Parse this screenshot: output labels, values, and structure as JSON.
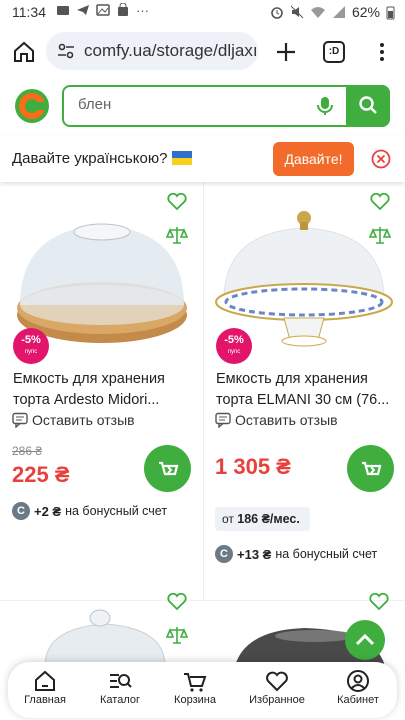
{
  "status_bar": {
    "time": "11:34",
    "battery": "62%"
  },
  "browser": {
    "url": "comfy.ua/storage/dljaxı",
    "tab_count": ":D"
  },
  "site": {
    "search_value": "блен"
  },
  "lang_banner": {
    "text": "Давайте українською?",
    "button": "Давайте!"
  },
  "products": [
    {
      "badge": "-5%",
      "badge_sub": "пупс",
      "name_line1": "Емкость для хранения",
      "name_line2": "торта Ardesto Midori...",
      "review": "Оставить отзыв",
      "old_price": "286 ₴",
      "price": "225 ₴",
      "bonus_amount": "+2 ₴",
      "bonus_text": "на бонусный счет"
    },
    {
      "badge": "-5%",
      "badge_sub": "пупс",
      "name_line1": "Емкость для хранения",
      "name_line2": "торта ELMANI 30 см (76...",
      "review": "Оставить отзыв",
      "price": "1 305 ₴",
      "credit_prefix": "от",
      "credit_value": "186 ₴/мес.",
      "bonus_amount": "+13 ₴",
      "bonus_text": "на бонусный счет"
    }
  ],
  "nav": [
    {
      "label": "Главная",
      "icon": "home-icon"
    },
    {
      "label": "Каталог",
      "icon": "catalog-icon"
    },
    {
      "label": "Корзина",
      "icon": "cart-icon"
    },
    {
      "label": "Избранное",
      "icon": "heart-icon"
    },
    {
      "label": "Кабинет",
      "icon": "user-icon"
    }
  ],
  "colors": {
    "brand_green": "#3fae3f",
    "price_red": "#e8413c",
    "banner_orange": "#f26b2a",
    "badge_pink": "#e3156b"
  }
}
